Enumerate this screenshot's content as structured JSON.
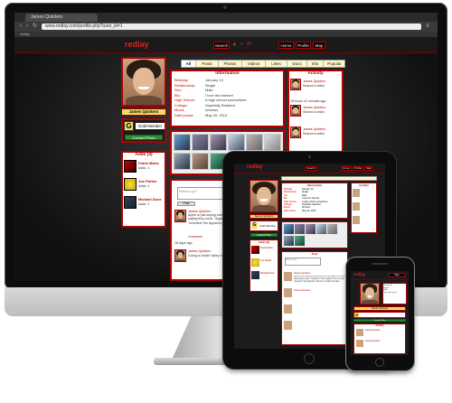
{
  "browser": {
    "tab_title": "James Quintero",
    "url": "www.redlay.com/profile.php?user_id=1",
    "bookmark": "redlay"
  },
  "site": {
    "logo": "redlay",
    "header_buttons": [
      "Search",
      "Home",
      "Profile",
      "Map"
    ]
  },
  "profile": {
    "name": "James Quintero",
    "membership": "Gold Member",
    "membership_badge": "G",
    "contact_button": "Contact Photo",
    "tabs": [
      "All",
      "Posts",
      "Photos",
      "Videos",
      "Likes",
      "Docs",
      "Info",
      "Popular"
    ],
    "info_title": "Information",
    "info": [
      {
        "label": "Birthday:",
        "value": "January 10"
      },
      {
        "label": "Relationship:",
        "value": "Single"
      },
      {
        "label": "Sex:",
        "value": "Male"
      },
      {
        "label": "Bio:",
        "value": "I love the internet"
      },
      {
        "label": "High School:",
        "value": "A high school somewhere"
      },
      {
        "label": "College:",
        "value": "Hopefully Stanford"
      },
      {
        "label": "Mood:",
        "value": "Anxious"
      },
      {
        "label": "Date joined:",
        "value": "May 20, 2013"
      }
    ],
    "adds_title": "Adds (3)",
    "adds": [
      {
        "name": "Frank Marts",
        "meta": "Adds: 1"
      },
      {
        "name": "Joe Parker",
        "meta": "Adds: 1"
      },
      {
        "name": "Michael Dove",
        "meta": "Adds: 1"
      }
    ],
    "activity_title": "Activity",
    "activity": [
      {
        "name": "James Quintero",
        "action": "Shared a video"
      },
      {
        "name": "James Quintero",
        "action": "Shared a video"
      },
      {
        "name": "James Quintero",
        "action": "Shared a video"
      }
    ],
    "activity_times": [
      "",
      "18 hours 41 minutes ago",
      "",
      ""
    ],
    "post_title": "Post",
    "post_placeholder": "What's up?",
    "post_button": "Post",
    "posts": [
      {
        "name": "James Quintero",
        "text": "Apple is just saying everything they had against Amazon saying they used. \"Appstore\" Sure Apple's the one that \"invented\" the Appstore. But it's a \"stupid\" product.",
        "time": "18 days ago",
        "comment": "Comment"
      },
      {
        "name": "James Quintero",
        "text": "Going to Death Valley for 4 days. Wish me luck!",
        "time": "",
        "comment": ""
      }
    ]
  }
}
